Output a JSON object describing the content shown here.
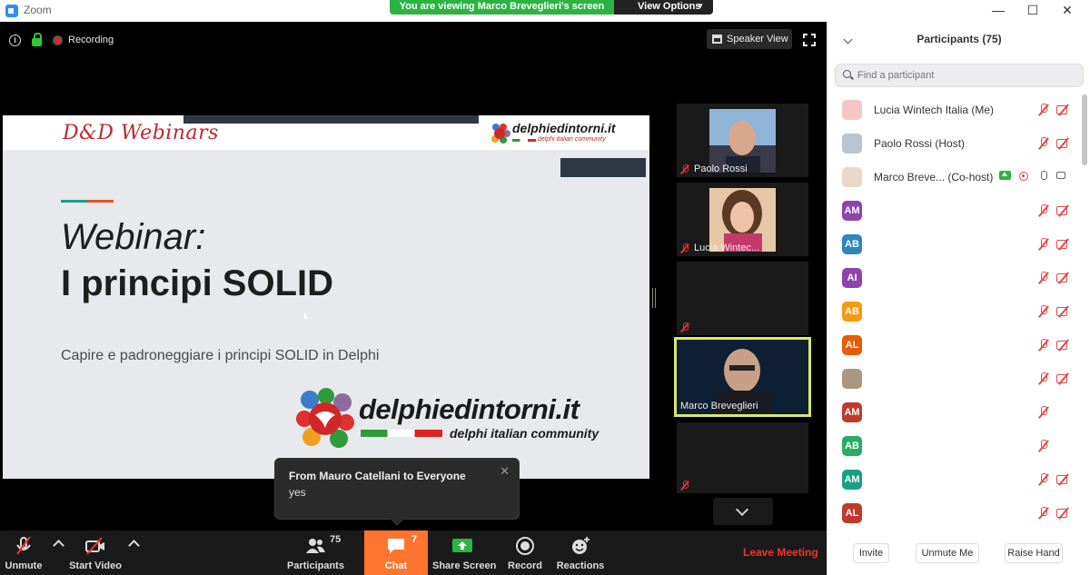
{
  "window": {
    "title": "Zoom"
  },
  "share_banner": {
    "text": "You are viewing Marco Breveglieri's screen",
    "view_options": "View Options"
  },
  "top": {
    "recording": "Recording",
    "speaker_view": "Speaker View"
  },
  "slide": {
    "header_logo": "D&D Webinars",
    "small_brand": "delphiedintorni.it",
    "small_brand_sub": "delphi italian community",
    "title_line1": "Webinar:",
    "title_line2": "I principi SOLID",
    "subtitle": "Capire e padroneggiare i principi SOLID in Delphi",
    "brand_name": "delphiedintorni.it",
    "brand_tagline": "delphi italian community"
  },
  "video_tiles": [
    {
      "name": "Paolo Rossi"
    },
    {
      "name": "Lucia Wintec..."
    },
    {
      "name": ""
    },
    {
      "name": "Marco Breveglieri"
    },
    {
      "name": ""
    }
  ],
  "chat_toast": {
    "from": "From Mauro Catellani to Everyone",
    "message": "yes"
  },
  "toolbar": {
    "unmute": "Unmute",
    "start_video": "Start Video",
    "participants": "Participants",
    "participants_count": "75",
    "chat": "Chat",
    "chat_count": "7",
    "share_screen": "Share Screen",
    "record": "Record",
    "reactions": "Reactions",
    "leave": "Leave Meeting"
  },
  "panel": {
    "title": "Participants (75)",
    "search_placeholder": "Find a participant",
    "participants": [
      {
        "name": "Lucia Wintech Italia (Me)",
        "initials": "",
        "color": "#f4c6c6"
      },
      {
        "name": "Paolo Rossi (Host)",
        "initials": "",
        "color": "#b8c4d0"
      },
      {
        "name": "Marco Breve...   (Co-host)",
        "initials": "",
        "color": "#e8d8c8"
      },
      {
        "name": "",
        "initials": "AM",
        "color": "#8e44ad"
      },
      {
        "name": "",
        "initials": "AB",
        "color": "#2e86c1"
      },
      {
        "name": "",
        "initials": "AI",
        "color": "#8e44ad"
      },
      {
        "name": "",
        "initials": "AB",
        "color": "#f39c12"
      },
      {
        "name": "",
        "initials": "AL",
        "color": "#e65c00"
      },
      {
        "name": "",
        "initials": "",
        "color": "#a89880"
      },
      {
        "name": "",
        "initials": "AM",
        "color": "#c0392b"
      },
      {
        "name": "",
        "initials": "AB",
        "color": "#27ae60"
      },
      {
        "name": "",
        "initials": "AM",
        "color": "#16a085"
      },
      {
        "name": "",
        "initials": "AL",
        "color": "#c0392b"
      }
    ],
    "invite": "Invite",
    "unmute_me": "Unmute Me",
    "raise_hand": "Raise Hand"
  }
}
